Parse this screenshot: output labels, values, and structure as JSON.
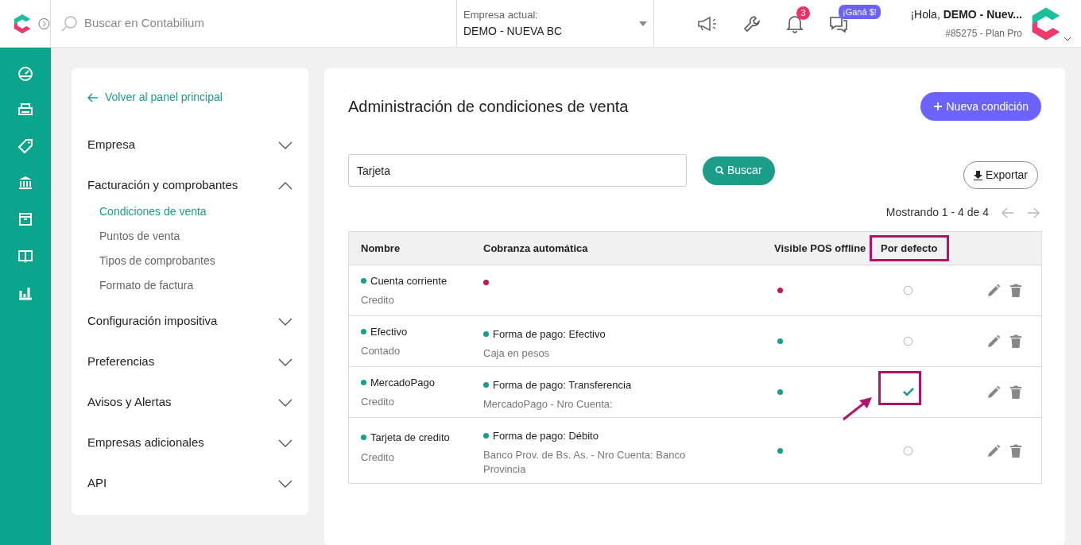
{
  "topbar": {
    "search_placeholder": "Buscar en Contabilium",
    "company_label": "Empresa actual:",
    "company_value": "DEMO - NUEVA BC",
    "notifications_count": "3",
    "promo_badge": "¡Ganá $!",
    "greeting": "¡Hola, **DEMO - Nuev...**",
    "account": "#85275 - Plan Pro"
  },
  "sidebar": {
    "back_link": "Volver al panel principal",
    "sections": [
      {
        "label": "Empresa",
        "expanded": false
      },
      {
        "label": "Facturación y comprobantes",
        "expanded": true,
        "children": [
          {
            "label": "Condiciones de venta",
            "selected": true
          },
          {
            "label": "Puntos de venta",
            "selected": false
          },
          {
            "label": "Tipos de comprobantes",
            "selected": false
          },
          {
            "label": "Formato de factura",
            "selected": false
          }
        ]
      },
      {
        "label": "Configuración impositiva",
        "expanded": false
      },
      {
        "label": "Preferencias",
        "expanded": false
      },
      {
        "label": "Avisos y Alertas",
        "expanded": false
      },
      {
        "label": "Empresas adicionales",
        "expanded": false
      },
      {
        "label": "API",
        "expanded": false
      }
    ]
  },
  "main": {
    "title": "Administración de condiciones de venta",
    "new_button": "Nueva condición",
    "search_value": "Tarjeta",
    "search_button": "Buscar",
    "export_button": "Exportar",
    "pagination": "Mostrando 1 - 4 de 4",
    "table": {
      "columns": [
        {
          "label": "Nombre",
          "highlighted": false
        },
        {
          "label": "Cobranza automática",
          "highlighted": false
        },
        {
          "label": "Visible POS offline",
          "highlighted": false
        },
        {
          "label": "Por defecto",
          "highlighted": true
        }
      ],
      "rows": [
        {
          "name": "Cuenta corriente",
          "type": "Credito",
          "name_active": true,
          "collection_active": false,
          "pos_visible": false,
          "is_default": false,
          "highlighted": false
        },
        {
          "name": "Efectivo",
          "type": "Contado",
          "name_active": true,
          "collection_active": true,
          "collection": "Forma de pago: Efectivo",
          "collection_detail": "Caja en pesos",
          "pos_visible": true,
          "is_default": false,
          "highlighted": false
        },
        {
          "name": "MercadoPago",
          "type": "Credito",
          "name_active": true,
          "collection_active": true,
          "collection": "Forma de pago: Transferencia",
          "collection_detail": "MercadoPago - Nro Cuenta:",
          "pos_visible": true,
          "is_default": true,
          "highlighted": true
        },
        {
          "name": "Tarjeta de credito",
          "type": "Credito",
          "name_active": true,
          "collection_active": true,
          "collection": "Forma de pago: Débito",
          "collection_detail": "Banco Prov. de Bs. As. - Nro Cuenta: Banco Provincia",
          "pos_visible": true,
          "is_default": false,
          "highlighted": false
        }
      ]
    }
  }
}
